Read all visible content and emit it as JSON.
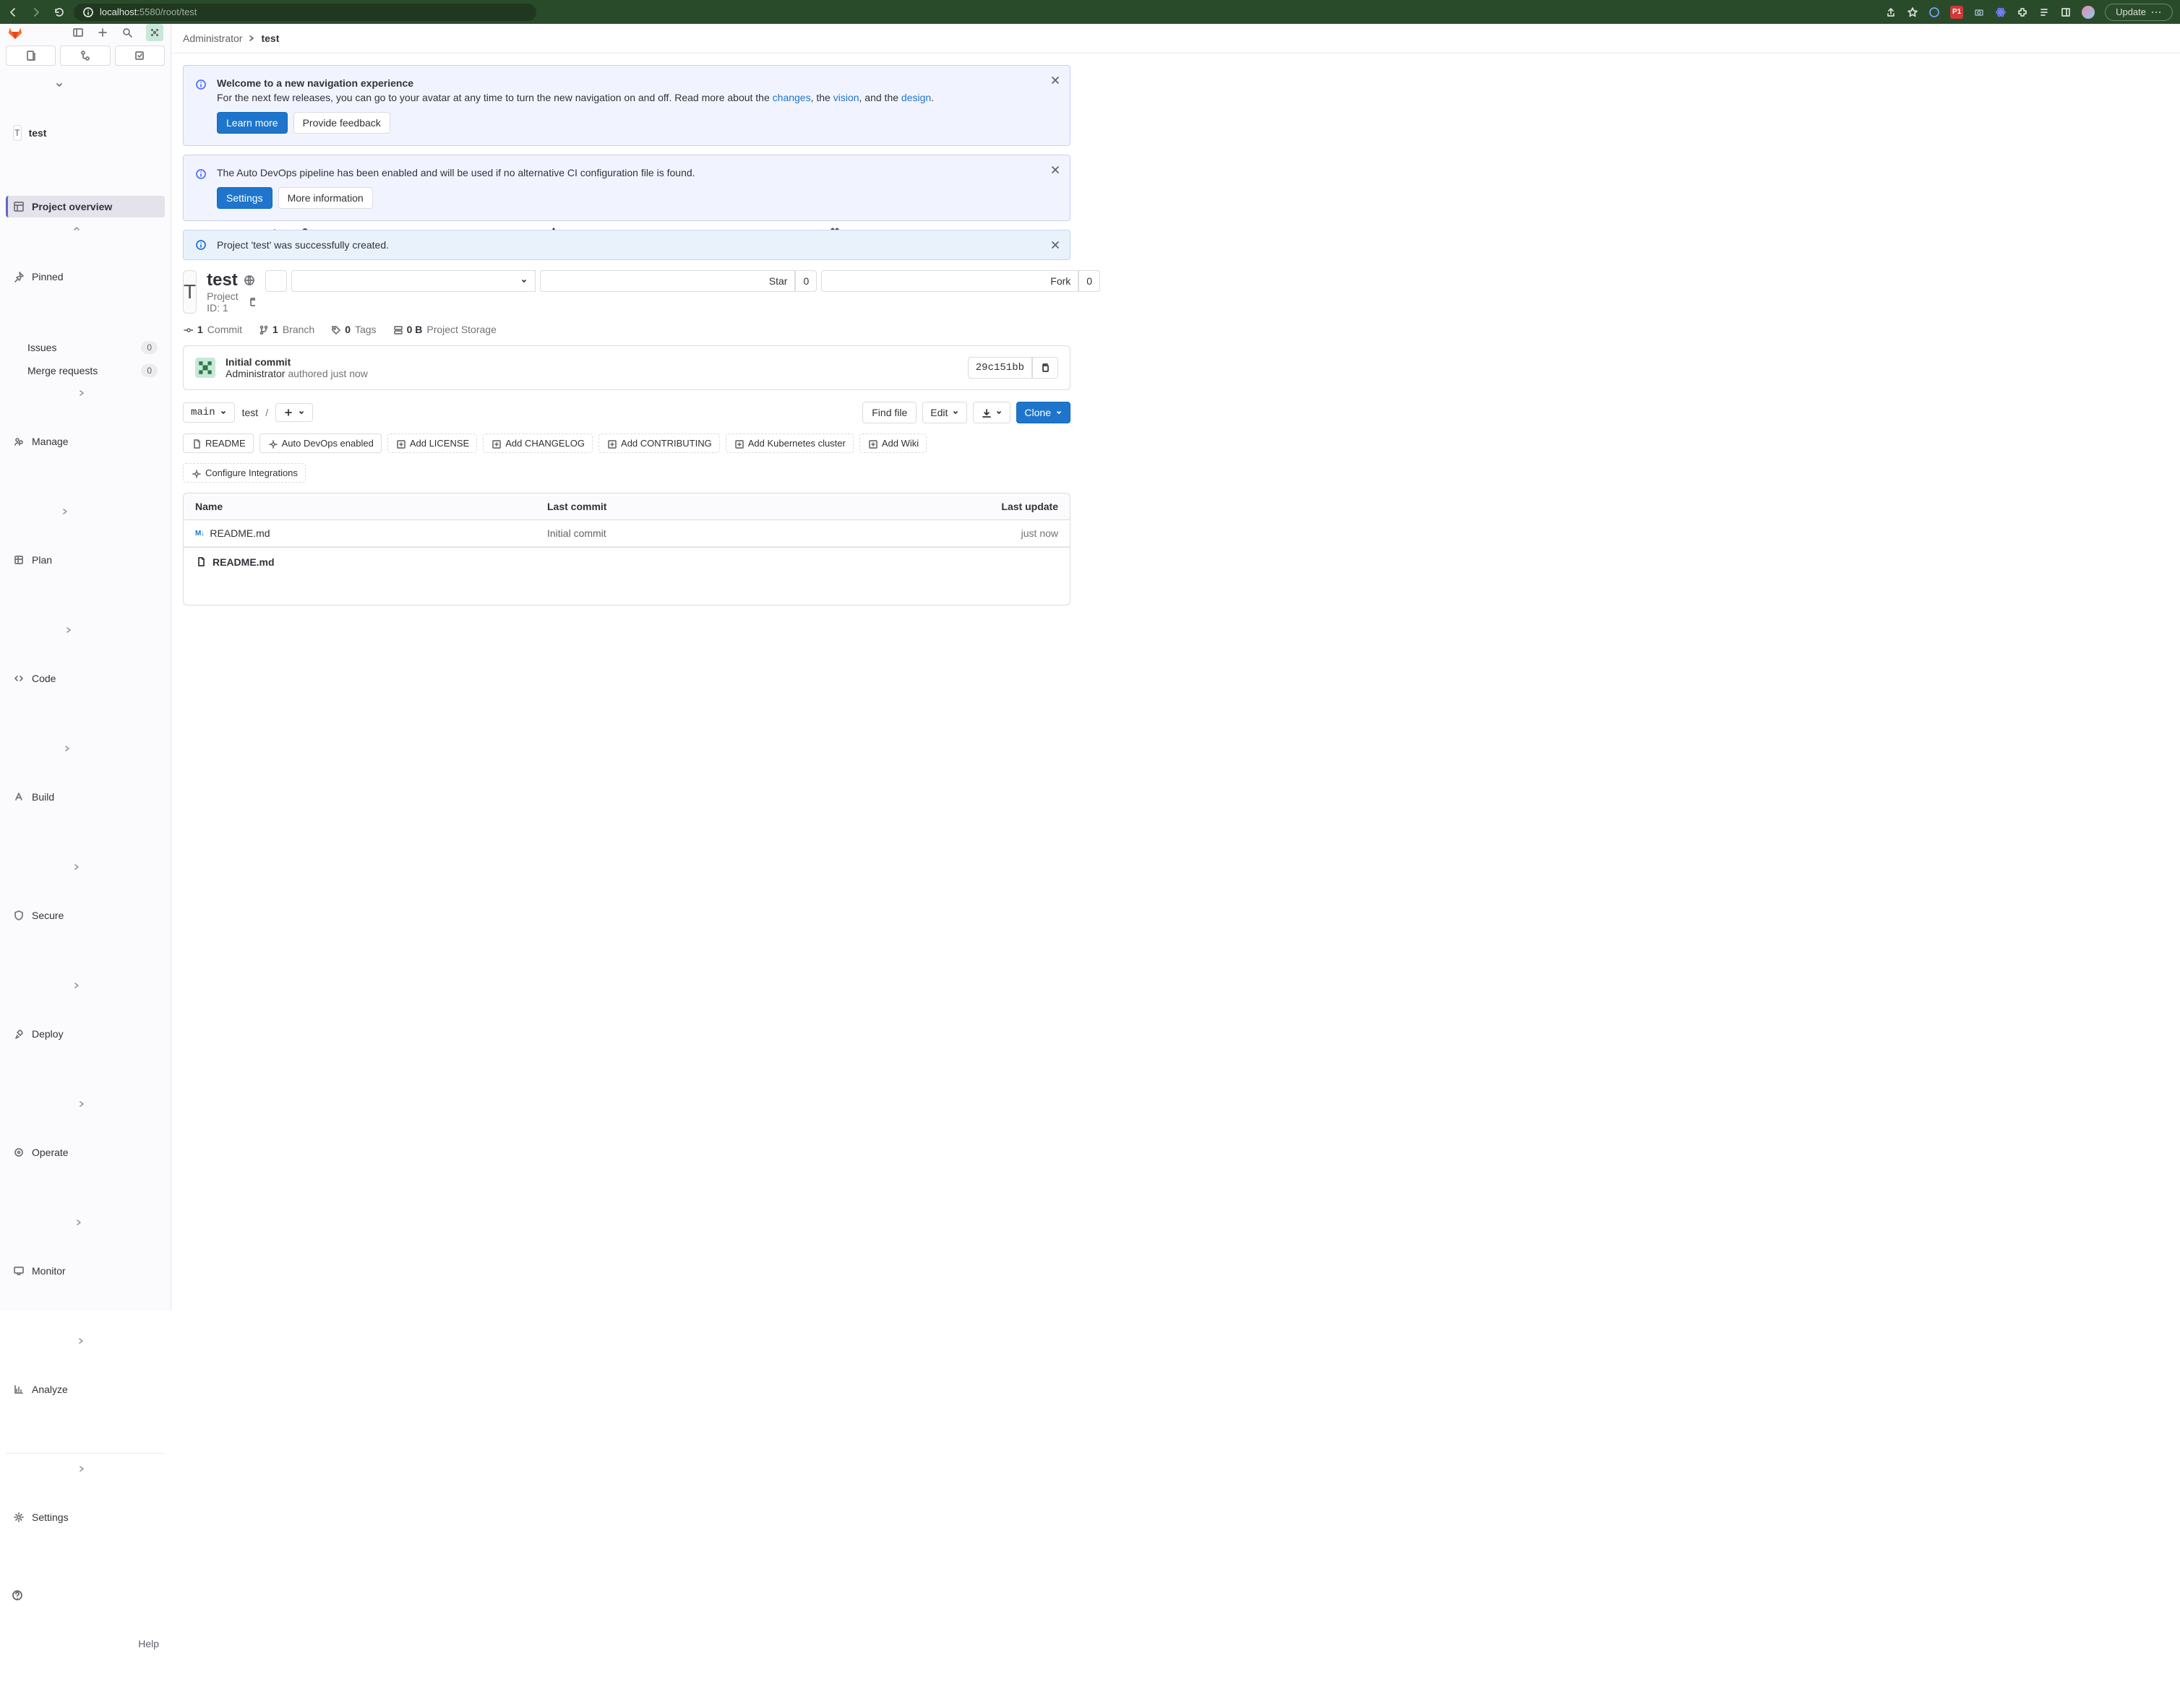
{
  "browser": {
    "url_host": "localhost:",
    "url_port": "5580",
    "url_path": "/root/test",
    "update": "Update",
    "p1": "P1"
  },
  "sidebar": {
    "project_letter": "T",
    "project_name": "test",
    "overview": "Project overview",
    "pinned": "Pinned",
    "issues": {
      "label": "Issues",
      "count": "0"
    },
    "mrs": {
      "label": "Merge requests",
      "count": "0"
    },
    "manage": "Manage",
    "plan": "Plan",
    "code": "Code",
    "build": "Build",
    "secure": "Secure",
    "deploy": "Deploy",
    "operate": "Operate",
    "monitor": "Monitor",
    "analyze": "Analyze",
    "settings": "Settings",
    "help": "Help"
  },
  "breadcrumb": {
    "a": "Administrator",
    "b": "test"
  },
  "alerts": {
    "nav": {
      "title": "Welcome to a new navigation experience",
      "pre": "For the next few releases, you can go to your avatar at any time to turn the new navigation on and off. Read more about the ",
      "l1": "changes",
      "m1": ", the ",
      "l2": "vision",
      "m2": ", and the ",
      "l3": "design",
      "post": ".",
      "learn_more": "Learn more",
      "feedback": "Provide feedback"
    },
    "devops": {
      "text": "The Auto DevOps pipeline has been enabled and will be used if no alternative CI configuration file is found.",
      "settings": "Settings",
      "more": "More information"
    },
    "created": "Project 'test' was successfully created."
  },
  "project": {
    "name": "test",
    "id_label": "Project ID: 1",
    "commits": "1",
    "commits_label": "Commit",
    "branches": "1",
    "branches_label": "Branch",
    "tags": "0",
    "tags_label": "Tags",
    "storage": "0 B",
    "storage_label": "Project Storage",
    "star": "Star",
    "star_count": "0",
    "fork": "Fork",
    "fork_count": "0"
  },
  "commit": {
    "title": "Initial commit",
    "author": "Administrator",
    "when": "authored just now",
    "sha": "29c151bb"
  },
  "filebar": {
    "branch": "main",
    "path": "test",
    "find": "Find file",
    "edit": "Edit",
    "clone": "Clone"
  },
  "chips": {
    "readme": "README",
    "devops": "Auto DevOps enabled",
    "license": "Add LICENSE",
    "changelog": "Add CHANGELOG",
    "contrib": "Add CONTRIBUTING",
    "k8s": "Add Kubernetes cluster",
    "wiki": "Add Wiki",
    "integ": "Configure Integrations"
  },
  "tree": {
    "h_name": "Name",
    "h_commit": "Last commit",
    "h_update": "Last update",
    "row": {
      "name": "README.md",
      "commit": "Initial commit",
      "update": "just now",
      "badge": "M↓"
    }
  },
  "readme": {
    "title": "README.md"
  }
}
